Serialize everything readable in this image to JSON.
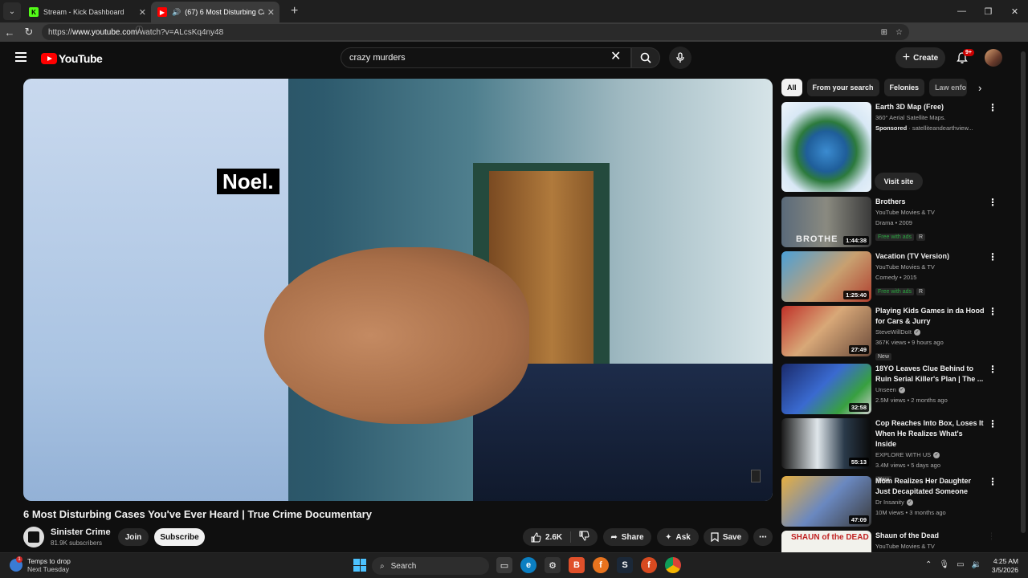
{
  "browser": {
    "tabs": [
      {
        "title": "Stream - Kick Dashboard",
        "active": false
      },
      {
        "title": "(67) 6 Most Disturbing Cases Yo",
        "active": true
      }
    ],
    "url_prefix": "https://",
    "url_host": "www.youtube.com",
    "url_path": "/watch?v=ALcsKq4ny48"
  },
  "header": {
    "logo_text": "YouTube",
    "search_query": "crazy murders",
    "create_label": "Create",
    "notification_count": "9+"
  },
  "video": {
    "caption_overlay": "Noel.",
    "title": "6 Most Disturbing Cases You've Ever Heard | True Crime Documentary",
    "channel_name": "Sinister Crime",
    "channel_subscribers": "81.9K subscribers",
    "join_label": "Join",
    "subscribe_label": "Subscribe",
    "likes": "2.6K",
    "share_label": "Share",
    "ask_label": "Ask",
    "save_label": "Save"
  },
  "chips": [
    "All",
    "From your search",
    "Felonies",
    "Law enfo"
  ],
  "sidebar": {
    "ad": {
      "title": "Earth 3D Map (Free)",
      "subtitle": "360° Aerial Satellite Maps.",
      "sponsored": "Sponsored",
      "domain": "· satelliteandearthview...",
      "cta": "Visit site"
    },
    "videos": [
      {
        "title": "Brothers",
        "channel": "YouTube Movies & TV",
        "meta": "Drama • 2009",
        "badge": "Free with ads",
        "rating": "R",
        "duration": "1:44:38"
      },
      {
        "title": "Vacation (TV Version)",
        "channel": "YouTube Movies & TV",
        "meta": "Comedy • 2015",
        "badge": "Free with ads",
        "rating": "R",
        "duration": "1:25:40"
      },
      {
        "title": "Playing Kids Games in da Hood for Cars & Jurry",
        "channel": "SteveWillDoIt",
        "meta": "367K views • 9 hours ago",
        "badge": "New",
        "duration": "27:49"
      },
      {
        "title": "18YO Leaves Clue Behind to Ruin Serial Killer's Plan | The ...",
        "channel": "Unseen",
        "meta": "2.5M views • 2 months ago",
        "duration": "32:58"
      },
      {
        "title": "Cop Reaches Into Box, Loses It When He Realizes What's Inside",
        "channel": "EXPLORE WITH US",
        "meta": "3.4M views • 5 days ago",
        "badge": "New",
        "duration": "55:13"
      },
      {
        "title": "Mom Realizes Her Daughter Just Decapitated Someone",
        "channel": "Dr Insanity",
        "meta": "10M views • 3 months ago",
        "duration": "47:09"
      },
      {
        "title": "Shaun of the Dead",
        "channel": "YouTube Movies & TV"
      }
    ],
    "thumb_texts": {
      "brothers": "BROTHE",
      "shaun": "SHAUN of the DEAD"
    }
  },
  "taskbar": {
    "weather_line1": "Temps to drop",
    "weather_line2": "Next Tuesday",
    "search_label": "Search",
    "time": "4:25 AM",
    "date": "3/5/2026"
  },
  "colors": {
    "youtube_red": "#ff0000",
    "accent_blue": "#4cc2ff",
    "free_green": "#2ba640"
  }
}
